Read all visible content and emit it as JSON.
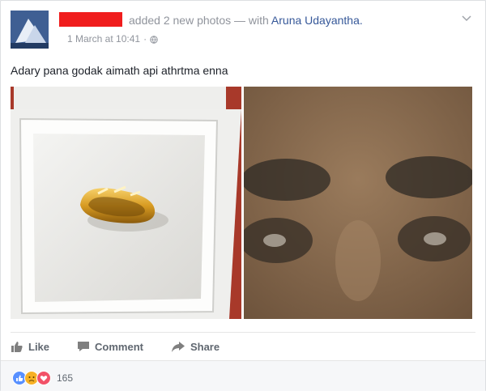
{
  "post": {
    "headline_prefix": "added 2 new photos — with",
    "tagged_name": "Aruna Udayantha.",
    "timestamp": "1 March at 10:41",
    "meta_sep": "·",
    "text": "Adary pana godak aimath api athrtma enna"
  },
  "actions": [
    {
      "label": "Like",
      "icon": "thumbs-up-icon"
    },
    {
      "label": "Comment",
      "icon": "comment-icon"
    },
    {
      "label": "Share",
      "icon": "share-icon"
    }
  ],
  "reactions": {
    "icons": [
      "like-reaction",
      "sad-reaction",
      "love-reaction"
    ],
    "count": "165"
  },
  "colors": {
    "link": "#365899",
    "redact": "#f01d1d",
    "like": "#5890ff",
    "sad": "#f7b125",
    "love": "#f25268"
  }
}
